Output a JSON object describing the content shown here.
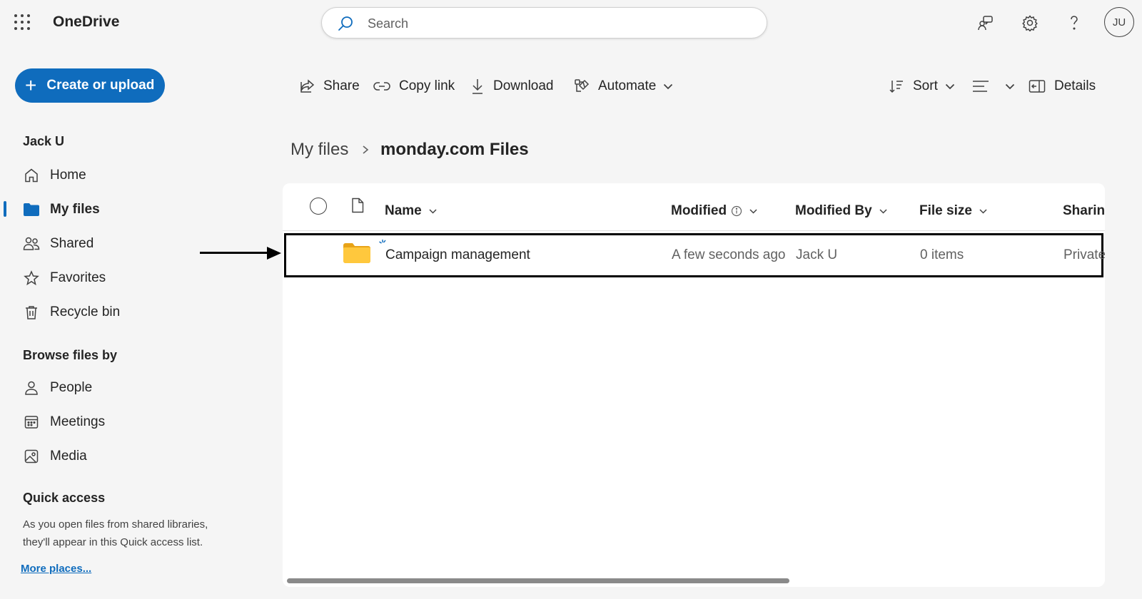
{
  "app": {
    "brand": "OneDrive"
  },
  "search": {
    "placeholder": "Search"
  },
  "user": {
    "initials": "JU"
  },
  "sidebar": {
    "create_label": "Create or upload",
    "user_name": "Jack U",
    "nav": [
      {
        "label": "Home",
        "icon": "home-icon"
      },
      {
        "label": "My files",
        "icon": "folder-icon",
        "active": true
      },
      {
        "label": "Shared",
        "icon": "people-icon"
      },
      {
        "label": "Favorites",
        "icon": "star-icon"
      },
      {
        "label": "Recycle bin",
        "icon": "trash-icon"
      }
    ],
    "browse_heading": "Browse files by",
    "browse": [
      {
        "label": "People",
        "icon": "person-icon"
      },
      {
        "label": "Meetings",
        "icon": "calendar-icon"
      },
      {
        "label": "Media",
        "icon": "image-icon"
      }
    ],
    "quick_access_heading": "Quick access",
    "quick_access_desc": "As you open files from shared libraries, they'll appear in this Quick access list.",
    "more_places": "More places..."
  },
  "commands": {
    "share": "Share",
    "copy_link": "Copy link",
    "download": "Download",
    "automate": "Automate",
    "sort": "Sort",
    "details": "Details"
  },
  "breadcrumb": {
    "parent": "My files",
    "current": "monday.com Files"
  },
  "table": {
    "columns": {
      "name": "Name",
      "modified": "Modified",
      "modified_by": "Modified By",
      "file_size": "File size",
      "sharing": "Sharing"
    },
    "rows": [
      {
        "name": "Campaign management",
        "modified": "A few seconds ago",
        "modified_by": "Jack U",
        "file_size": "0 items",
        "sharing": "Private"
      }
    ]
  },
  "colors": {
    "accent": "#0f6cbd",
    "folder": "#ffc83d",
    "background": "#f5f5f5"
  }
}
